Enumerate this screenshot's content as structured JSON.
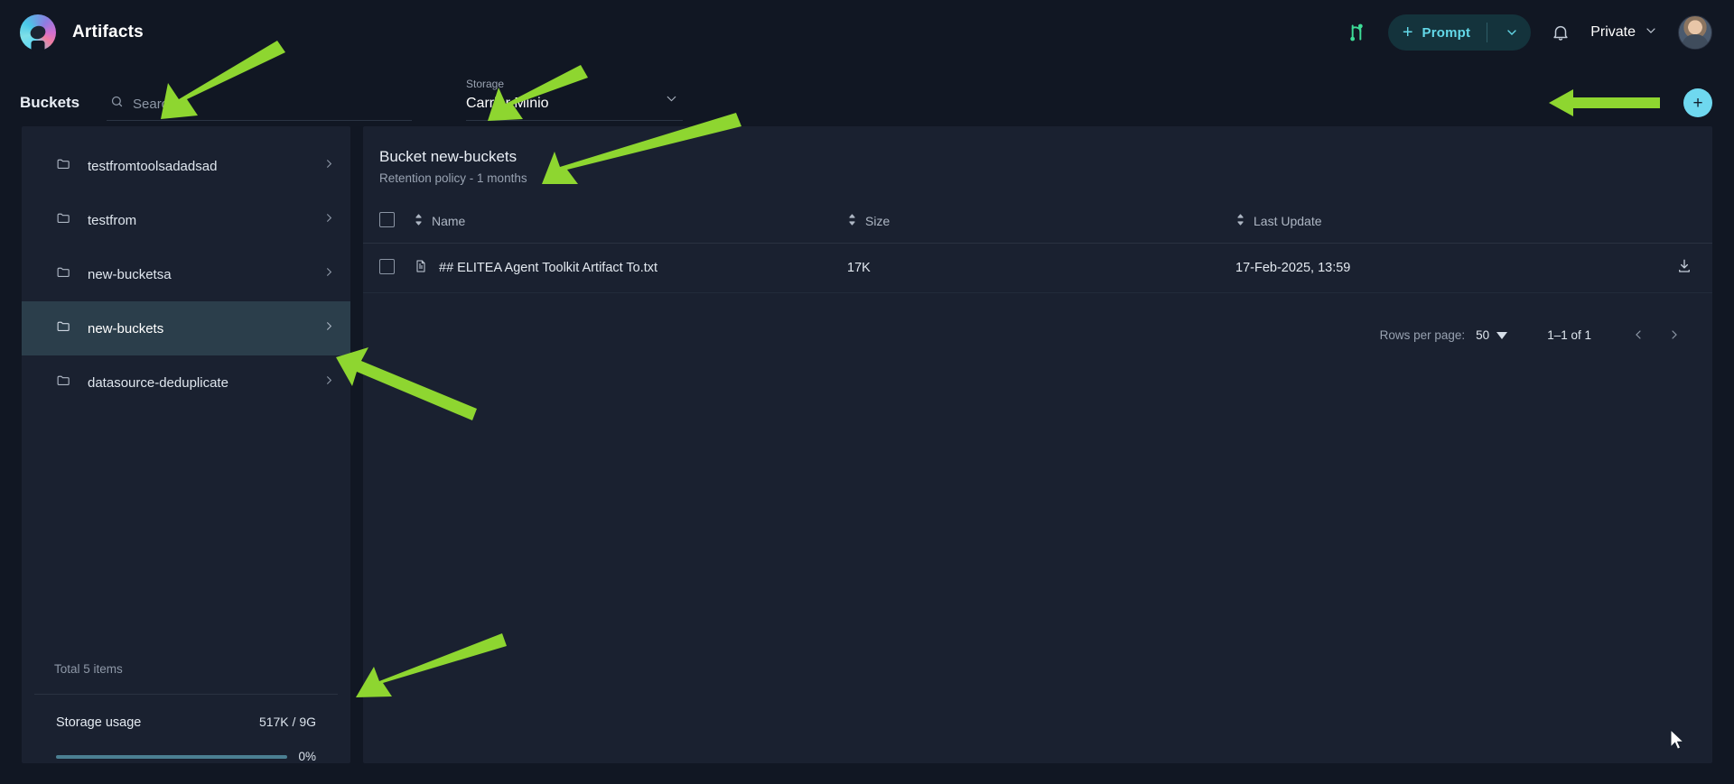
{
  "app": {
    "brand_title": "Artifacts",
    "logo_icon": "artifacts-logo-icon"
  },
  "topbar": {
    "toggle_icon": "compare-toggle-icon",
    "prompt_plus": "+",
    "prompt_label": "Prompt",
    "prompt_caret_icon": "chevron-down-icon",
    "bell_icon": "notification-bell-icon",
    "visibility_label": "Private",
    "visibility_caret_icon": "chevron-down-icon",
    "avatar_icon": "user-avatar"
  },
  "toolbar": {
    "section_title": "Buckets",
    "search_placeholder": "Search",
    "search_value": "",
    "search_icon": "search-icon",
    "storage_label": "Storage",
    "storage_value": "Carrier Minio",
    "storage_caret_icon": "chevron-down-icon",
    "add_label": "+"
  },
  "sidebar": {
    "items": [
      {
        "label": "testfromtoolsadadsad",
        "icon": "folder-icon",
        "chevron": "chevron-right-icon",
        "selected": false
      },
      {
        "label": "testfrom",
        "icon": "folder-icon",
        "chevron": "chevron-right-icon",
        "selected": false
      },
      {
        "label": "new-bucketsa",
        "icon": "folder-icon",
        "chevron": "chevron-right-icon",
        "selected": false
      },
      {
        "label": "new-buckets",
        "icon": "folder-icon",
        "chevron": "chevron-right-icon",
        "selected": true
      },
      {
        "label": "datasource-deduplicate",
        "icon": "folder-icon",
        "chevron": "chevron-right-icon",
        "selected": false
      }
    ],
    "total_items": "Total 5 items",
    "usage_label": "Storage usage",
    "usage_value": "517K / 9G",
    "usage_percent_label": "0%",
    "usage_percent": 0
  },
  "main": {
    "title": "Bucket new-buckets",
    "subtitle": "Retention policy - 1 months",
    "columns": [
      {
        "label": "Name",
        "sort_icon": "sort-arrows-icon"
      },
      {
        "label": "Size",
        "sort_icon": "sort-arrows-icon"
      },
      {
        "label": "Last Update",
        "sort_icon": "sort-arrows-icon"
      }
    ],
    "rows": [
      {
        "name": "## ELITEA Agent Toolkit Artifact To.txt",
        "size": "17K",
        "last_update": "17-Feb-2025, 13:59",
        "file_icon": "document-icon",
        "download_icon": "download-icon"
      }
    ],
    "pagination": {
      "rows_per_page_label": "Rows per page:",
      "rows_per_page_value": "50",
      "rows_per_page_caret": "caret-down-icon",
      "range_label": "1–1 of 1",
      "prev_icon": "chevron-left-icon",
      "next_icon": "chevron-right-icon"
    }
  },
  "colors": {
    "page_bg": "#111723",
    "panel_bg": "#1a2130",
    "accent_cyan": "#6fd8ef",
    "accent_teal_pill": "#14333c",
    "selected_row": "#2b3e4b",
    "annotation_arrow": "#8ed630"
  },
  "annotations": {
    "arrow_color": "#8ed630",
    "arrows": [
      {
        "name": "arrow-to-search"
      },
      {
        "name": "arrow-to-storage-select"
      },
      {
        "name": "arrow-to-bucket-title"
      },
      {
        "name": "arrow-to-add-button"
      },
      {
        "name": "arrow-to-selected-bucket"
      },
      {
        "name": "arrow-to-storage-usage"
      }
    ]
  },
  "cursor": {
    "icon": "mouse-pointer-icon"
  }
}
